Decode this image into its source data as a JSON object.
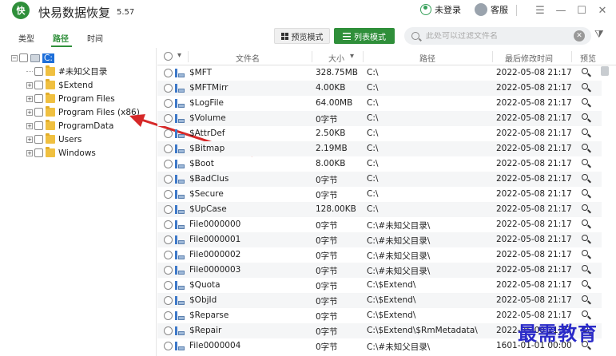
{
  "app": {
    "logo_text": "快",
    "title": "快易数据恢复",
    "version": "5.57",
    "user_label": "未登录",
    "service_label": "客服"
  },
  "tabs": [
    {
      "label": "类型",
      "active": false
    },
    {
      "label": "路径",
      "active": true
    },
    {
      "label": "时间",
      "active": false
    }
  ],
  "toolbar": {
    "preview_mode_label": "预览模式",
    "list_mode_label": "列表模式",
    "search_placeholder": "此处可以过滤文件名"
  },
  "tree": {
    "root_label": "C:",
    "items": [
      {
        "label": "#未知父目录",
        "expandable": false
      },
      {
        "label": "$Extend",
        "expandable": true
      },
      {
        "label": "Program Files",
        "expandable": true
      },
      {
        "label": "Program Files (x86)",
        "expandable": true
      },
      {
        "label": "ProgramData",
        "expandable": true
      },
      {
        "label": "Users",
        "expandable": true
      },
      {
        "label": "Windows",
        "expandable": true
      }
    ]
  },
  "table": {
    "columns": {
      "name": "文件名",
      "size": "大小",
      "path": "路径",
      "modified": "最后修改时间",
      "preview": "预览"
    },
    "rows": [
      {
        "name": "$MFT",
        "size": "328.75MB",
        "path": "C:\\",
        "modified": "2022-05-08  21:17"
      },
      {
        "name": "$MFTMirr",
        "size": "4.00KB",
        "path": "C:\\",
        "modified": "2022-05-08  21:17"
      },
      {
        "name": "$LogFile",
        "size": "64.00MB",
        "path": "C:\\",
        "modified": "2022-05-08  21:17"
      },
      {
        "name": "$Volume",
        "size": "0字节",
        "path": "C:\\",
        "modified": "2022-05-08  21:17"
      },
      {
        "name": "$AttrDef",
        "size": "2.50KB",
        "path": "C:\\",
        "modified": "2022-05-08  21:17"
      },
      {
        "name": "$Bitmap",
        "size": "2.19MB",
        "path": "C:\\",
        "modified": "2022-05-08  21:17"
      },
      {
        "name": "$Boot",
        "size": "8.00KB",
        "path": "C:\\",
        "modified": "2022-05-08  21:17"
      },
      {
        "name": "$BadClus",
        "size": "0字节",
        "path": "C:\\",
        "modified": "2022-05-08  21:17"
      },
      {
        "name": "$Secure",
        "size": "0字节",
        "path": "C:\\",
        "modified": "2022-05-08  21:17"
      },
      {
        "name": "$UpCase",
        "size": "128.00KB",
        "path": "C:\\",
        "modified": "2022-05-08  21:17"
      },
      {
        "name": "File0000000",
        "size": "0字节",
        "path": "C:\\#未知父目录\\",
        "modified": "2022-05-08  21:17"
      },
      {
        "name": "File0000001",
        "size": "0字节",
        "path": "C:\\#未知父目录\\",
        "modified": "2022-05-08  21:17"
      },
      {
        "name": "File0000002",
        "size": "0字节",
        "path": "C:\\#未知父目录\\",
        "modified": "2022-05-08  21:17"
      },
      {
        "name": "File0000003",
        "size": "0字节",
        "path": "C:\\#未知父目录\\",
        "modified": "2022-05-08  21:17"
      },
      {
        "name": "$Quota",
        "size": "0字节",
        "path": "C:\\$Extend\\",
        "modified": "2022-05-08  21:17"
      },
      {
        "name": "$ObjId",
        "size": "0字节",
        "path": "C:\\$Extend\\",
        "modified": "2022-05-08  21:17"
      },
      {
        "name": "$Reparse",
        "size": "0字节",
        "path": "C:\\$Extend\\",
        "modified": "2022-05-08  21:17"
      },
      {
        "name": "$Repair",
        "size": "0字节",
        "path": "C:\\$Extend\\$RmMetadata\\",
        "modified": "2022-05-08  21:17"
      },
      {
        "name": "File0000004",
        "size": "0字节",
        "path": "C:\\#未知父目录\\",
        "modified": "1601-01-01  00:00"
      }
    ]
  },
  "watermark": "最需教育",
  "colors": {
    "accent": "#2f8f3a",
    "selection": "#1e6fd9",
    "arrow": "#d62828",
    "watermark": "#2a2ac8"
  },
  "icons": {
    "search": "search-icon",
    "clear": "clear-icon",
    "filter": "filter-icon",
    "preview": "magnifier-icon"
  }
}
